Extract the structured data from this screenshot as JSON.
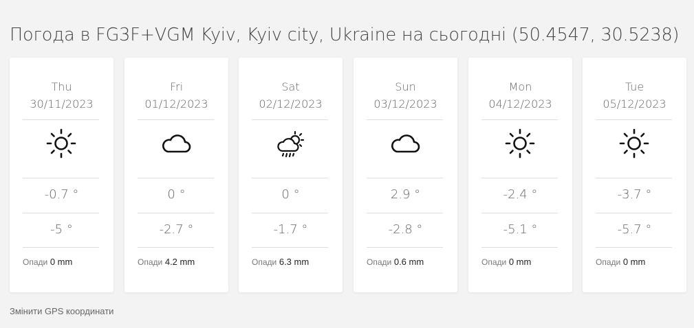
{
  "title": "Погода в FG3F+VGM Kyiv, Kyiv city, Ukraine на сьогодні (50.4547, 30.5238)",
  "precip_label": "Опади",
  "change_gps_label": "Змінити GPS координати",
  "days": [
    {
      "day": "Thu",
      "date": "30/11/2023",
      "icon": "sun-icon",
      "t_max": "-0.7 °",
      "t_min": "-5 °",
      "precip": "0 mm"
    },
    {
      "day": "Fri",
      "date": "01/12/2023",
      "icon": "cloud-icon",
      "t_max": "0 °",
      "t_min": "-2.7 °",
      "precip": "4.2 mm"
    },
    {
      "day": "Sat",
      "date": "02/12/2023",
      "icon": "rain-cloud-sun-icon",
      "t_max": "0 °",
      "t_min": "-1.7 °",
      "precip": "6.3 mm"
    },
    {
      "day": "Sun",
      "date": "03/12/2023",
      "icon": "cloud-icon",
      "t_max": "2.9 °",
      "t_min": "-2.8 °",
      "precip": "0.6 mm"
    },
    {
      "day": "Mon",
      "date": "04/12/2023",
      "icon": "sun-icon",
      "t_max": "-2.4 °",
      "t_min": "-5.1 °",
      "precip": "0 mm"
    },
    {
      "day": "Tue",
      "date": "05/12/2023",
      "icon": "sun-icon",
      "t_max": "-3.7 °",
      "t_min": "-5.7 °",
      "precip": "0 mm"
    }
  ]
}
